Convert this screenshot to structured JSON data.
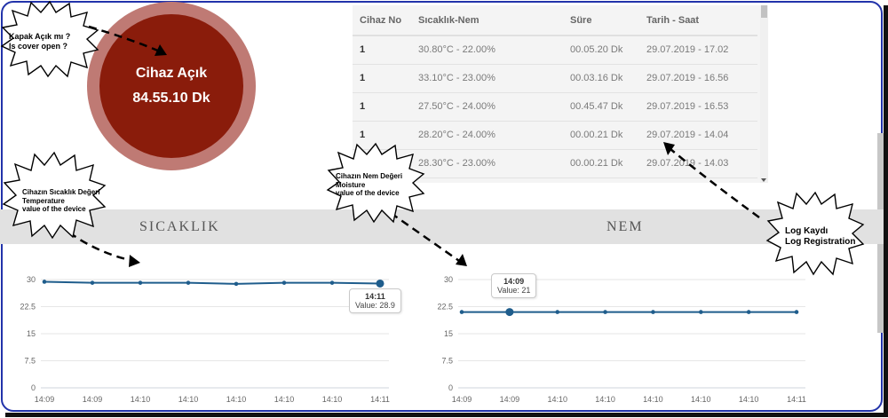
{
  "device": {
    "status": "Cihaz Açık",
    "duration": "84.55.10 Dk"
  },
  "log_table": {
    "headers": [
      "Cihaz No",
      "Sıcaklık-Nem",
      "Süre",
      "Tarih - Saat"
    ],
    "rows": [
      [
        "1",
        "30.80°C - 22.00%",
        "00.05.20 Dk",
        "29.07.2019 - 17.02"
      ],
      [
        "1",
        "33.10°C - 23.00%",
        "00.03.16 Dk",
        "29.07.2019 - 16.56"
      ],
      [
        "1",
        "27.50°C - 24.00%",
        "00.45.47 Dk",
        "29.07.2019 - 16.53"
      ],
      [
        "1",
        "28.20°C - 24.00%",
        "00.00.21 Dk",
        "29.07.2019 - 14.04"
      ],
      [
        "1",
        "28.30°C - 23.00%",
        "00.00.21 Dk",
        "29.07.2019 - 14.03"
      ]
    ]
  },
  "sections": {
    "temperature": "SICAKLIK",
    "humidity": "NEM"
  },
  "annotations": {
    "cover": "Kapak Açık mı ?\nIs cover open ?",
    "temperature": "Cihazın Sıcaklık Değeri\nTemperature\nvalue of the device",
    "moisture": "Cihazın Nem Değeri\nMoisture\nvalue of the device",
    "log": "Log Kaydı\nLog Registration"
  },
  "colors": {
    "device_ring": "#bf7a74",
    "device_core": "#8a1c0b",
    "line": "#1f5d8c",
    "frame": "#2233aa"
  },
  "chart_data": [
    {
      "type": "line",
      "x": [
        "14:09",
        "14:09",
        "14:10",
        "14:10",
        "14:10",
        "14:10",
        "14:10",
        "14:11"
      ],
      "series": [
        {
          "values": [
            29.4,
            29.1,
            29.1,
            29.1,
            28.8,
            29.1,
            29.1,
            28.9
          ]
        }
      ],
      "yticks": [
        "0",
        "7.5",
        "15",
        "22.5",
        "30"
      ],
      "ylim": [
        0,
        30
      ],
      "grid": true,
      "tooltip": {
        "time": "14:11",
        "label": "Value: 28.9",
        "index": 7
      }
    },
    {
      "type": "line",
      "x": [
        "14:09",
        "14:09",
        "14:10",
        "14:10",
        "14:10",
        "14:10",
        "14:10",
        "14:11"
      ],
      "series": [
        {
          "values": [
            21,
            21,
            21,
            21,
            21,
            21,
            21,
            21
          ]
        }
      ],
      "yticks": [
        "0",
        "7.5",
        "15",
        "22.5",
        "30"
      ],
      "ylim": [
        0,
        30
      ],
      "grid": true,
      "tooltip": {
        "time": "14:09",
        "label": "Value: 21",
        "index": 1
      }
    }
  ]
}
